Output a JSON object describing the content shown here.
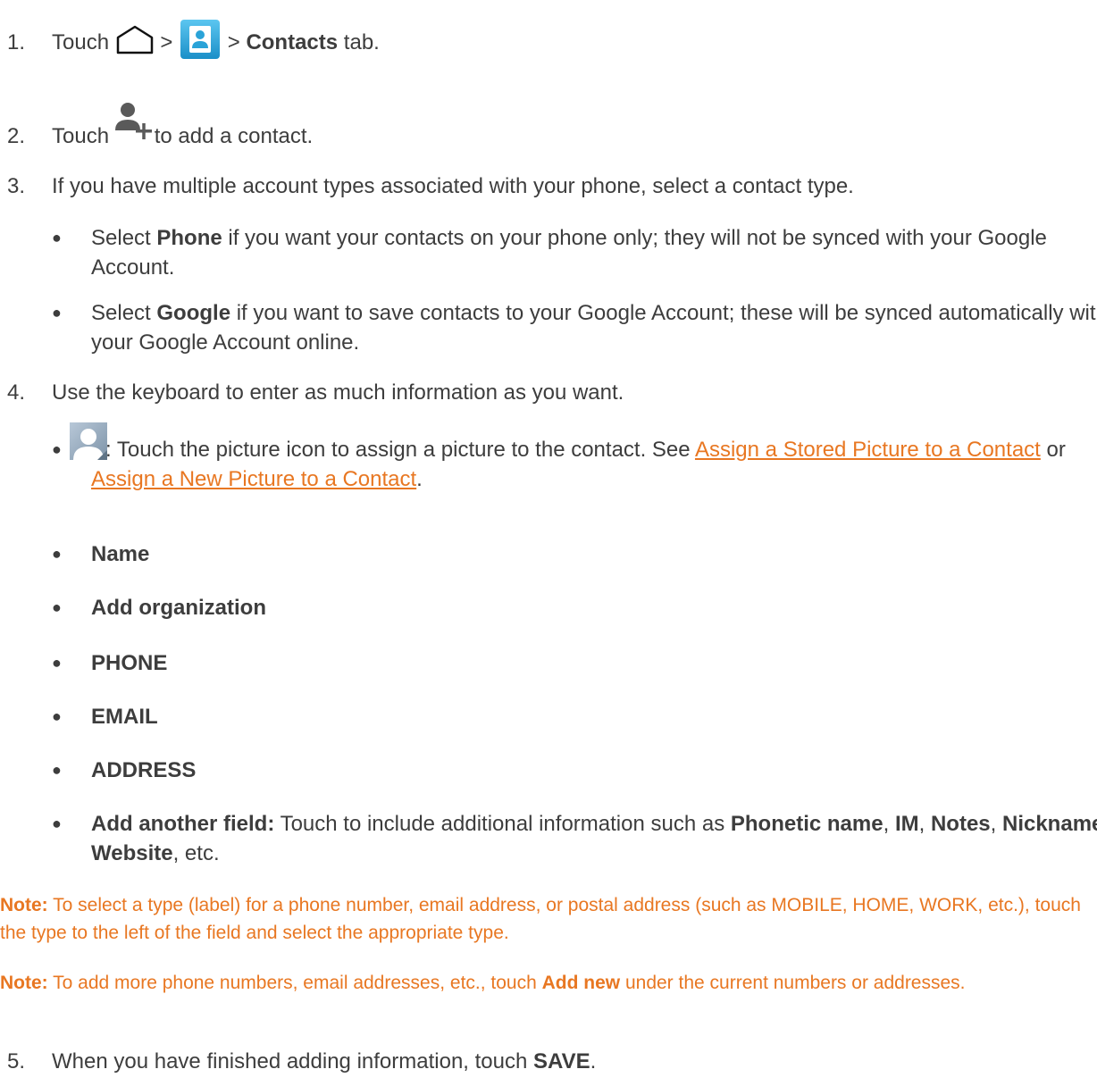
{
  "steps": [
    {
      "num": "1.",
      "touch": "Touch",
      "gt1": ">",
      "gt2": ">",
      "contacts": "Contacts",
      "tab": "tab."
    },
    {
      "num": "2.",
      "touch": "Touch",
      "rest": "to add a contact."
    },
    {
      "num": "3.",
      "text": "If you have multiple account types associated with your phone, select a contact type."
    },
    {
      "num": "4.",
      "text": "Use the keyboard to enter as much information as you want."
    },
    {
      "num": "5.",
      "text": "When you have finished adding information, touch",
      "save": "SAVE",
      "end": "."
    }
  ],
  "step3_bullets": {
    "phone": {
      "pre": "Select",
      "bold": "Phone",
      "post": "if you want your contacts on your phone only; they will not be synced with your Google Account."
    },
    "google": {
      "pre": "Select",
      "bold": "Google",
      "post": "if you want to save contacts to your Google Account; these will be synced automatically with your Google Account online."
    }
  },
  "step4_bullets": {
    "picture": {
      "text": ": Touch the picture icon to assign a picture to the contact. See",
      "link1": "Assign a Stored Picture to a Contact",
      "or": "or",
      "link2": "Assign a New Picture to a Contact",
      "end": "."
    },
    "name": "Name",
    "org": "Add organization",
    "phone": "PHONE",
    "email": "EMAIL",
    "address": "ADDRESS",
    "another": {
      "label": "Add another field:",
      "text": "Touch to include additional information such as",
      "b1": "Phonetic name",
      "c1": ",",
      "b2": "IM",
      "c2": ",",
      "b3": "Notes",
      "c3": ",",
      "b4": "Nickname",
      "c4": ",",
      "b5": "Website",
      "end": ", etc."
    }
  },
  "notes": [
    {
      "label": "Note:",
      "text": "To select a type (label) for a phone number, email address, or postal address (such as MOBILE, HOME, WORK, etc.), touch the type to the left of the field and select the appropriate type."
    },
    {
      "label": "Note:",
      "text": "To add more phone numbers, email addresses, etc., touch",
      "bold": "Add new",
      "post": "under the current numbers or addresses."
    }
  ],
  "bullet_char": "●",
  "colors": {
    "text": "#3d3d3d",
    "accent": "#e87722",
    "contacts_icon": "#2aa3d8"
  },
  "icons": [
    "home-icon",
    "contacts-app-icon",
    "add-contact-icon",
    "contact-picture-icon"
  ]
}
